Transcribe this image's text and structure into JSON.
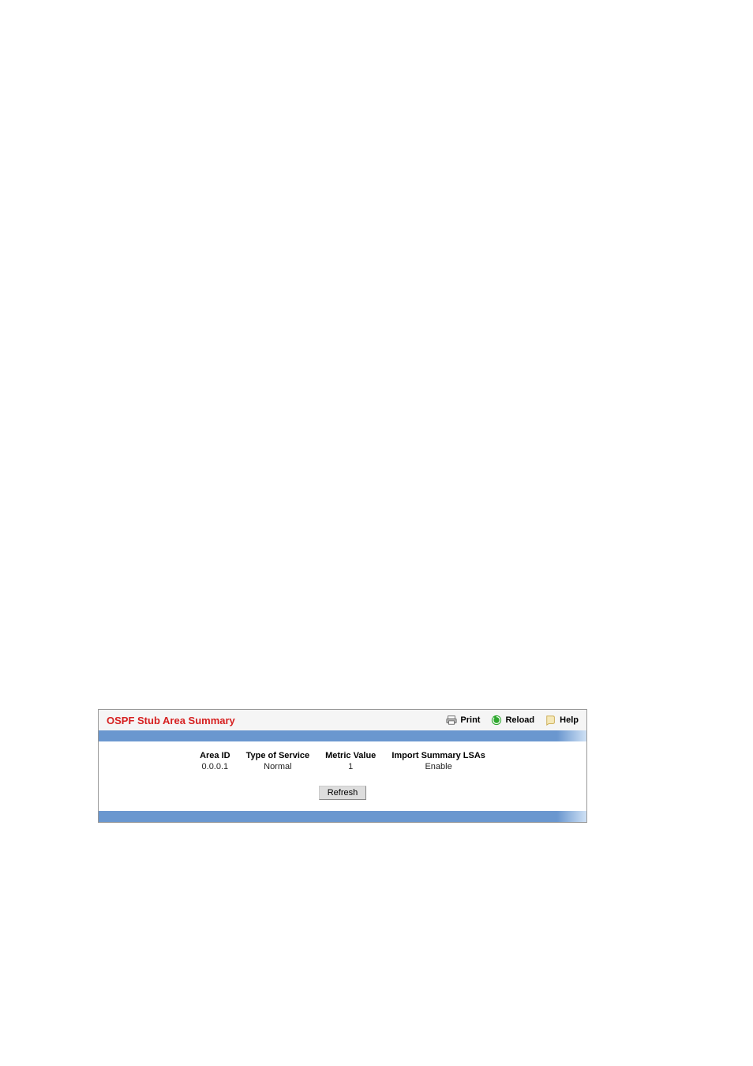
{
  "header": {
    "title": "OSPF Stub Area Summary",
    "toolbar": {
      "print": "Print",
      "reload": "Reload",
      "help": "Help"
    }
  },
  "table": {
    "columns": [
      "Area ID",
      "Type of Service",
      "Metric Value",
      "Import Summary LSAs"
    ],
    "rows": [
      {
        "area_id": "0.0.0.1",
        "type_of_service": "Normal",
        "metric_value": "1",
        "import_summary_lsas": "Enable"
      }
    ]
  },
  "buttons": {
    "refresh": "Refresh"
  }
}
